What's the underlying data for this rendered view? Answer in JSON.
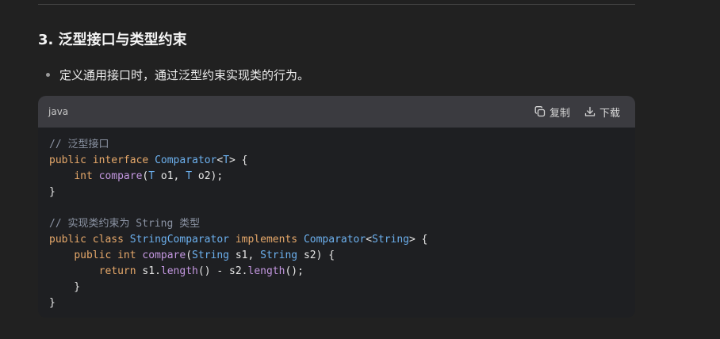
{
  "section": {
    "heading": "3. 泛型接口与类型约束",
    "bullet": "定义通用接口时，通过泛型约束实现类的行为。"
  },
  "code_block": {
    "language": "java",
    "copy_label": "复制",
    "download_label": "下载",
    "lines": [
      [
        {
          "t": "// 泛型接口",
          "c": "comment"
        }
      ],
      [
        {
          "t": "public",
          "c": "kw"
        },
        {
          "t": " ",
          "c": "plain"
        },
        {
          "t": "interface",
          "c": "kw"
        },
        {
          "t": " ",
          "c": "plain"
        },
        {
          "t": "Comparator",
          "c": "type"
        },
        {
          "t": "<",
          "c": "plain"
        },
        {
          "t": "T",
          "c": "type"
        },
        {
          "t": "> {",
          "c": "plain"
        }
      ],
      [
        {
          "t": "    ",
          "c": "plain"
        },
        {
          "t": "int",
          "c": "kw"
        },
        {
          "t": " ",
          "c": "plain"
        },
        {
          "t": "compare",
          "c": "fn"
        },
        {
          "t": "(",
          "c": "plain"
        },
        {
          "t": "T",
          "c": "type"
        },
        {
          "t": " o1, ",
          "c": "plain"
        },
        {
          "t": "T",
          "c": "type"
        },
        {
          "t": " o2);",
          "c": "plain"
        }
      ],
      [
        {
          "t": "}",
          "c": "plain"
        }
      ],
      [
        {
          "t": "",
          "c": "plain"
        }
      ],
      [
        {
          "t": "// 实现类约束为 String 类型",
          "c": "comment"
        }
      ],
      [
        {
          "t": "public",
          "c": "kw"
        },
        {
          "t": " ",
          "c": "plain"
        },
        {
          "t": "class",
          "c": "kw"
        },
        {
          "t": " ",
          "c": "plain"
        },
        {
          "t": "StringComparator",
          "c": "type"
        },
        {
          "t": " ",
          "c": "plain"
        },
        {
          "t": "implements",
          "c": "kw"
        },
        {
          "t": " ",
          "c": "plain"
        },
        {
          "t": "Comparator",
          "c": "type"
        },
        {
          "t": "<",
          "c": "plain"
        },
        {
          "t": "String",
          "c": "type"
        },
        {
          "t": "> {",
          "c": "plain"
        }
      ],
      [
        {
          "t": "    ",
          "c": "plain"
        },
        {
          "t": "public",
          "c": "kw"
        },
        {
          "t": " ",
          "c": "plain"
        },
        {
          "t": "int",
          "c": "kw"
        },
        {
          "t": " ",
          "c": "plain"
        },
        {
          "t": "compare",
          "c": "fn"
        },
        {
          "t": "(",
          "c": "plain"
        },
        {
          "t": "String",
          "c": "type"
        },
        {
          "t": " s1, ",
          "c": "plain"
        },
        {
          "t": "String",
          "c": "type"
        },
        {
          "t": " s2) {",
          "c": "plain"
        }
      ],
      [
        {
          "t": "        ",
          "c": "plain"
        },
        {
          "t": "return",
          "c": "kw"
        },
        {
          "t": " s1.",
          "c": "plain"
        },
        {
          "t": "length",
          "c": "fn"
        },
        {
          "t": "() - s2.",
          "c": "plain"
        },
        {
          "t": "length",
          "c": "fn"
        },
        {
          "t": "();",
          "c": "plain"
        }
      ],
      [
        {
          "t": "    }",
          "c": "plain"
        }
      ],
      [
        {
          "t": "}",
          "c": "plain"
        }
      ]
    ]
  },
  "icons": {
    "copy": "copy-icon",
    "download": "download-icon"
  },
  "colors": {
    "background": "#212121",
    "code_background": "#1e1f22",
    "code_header": "#3b3b40",
    "keyword": "#e6a86a",
    "type": "#6cb0ee",
    "function": "#c397e0",
    "comment": "#8b93a3"
  }
}
